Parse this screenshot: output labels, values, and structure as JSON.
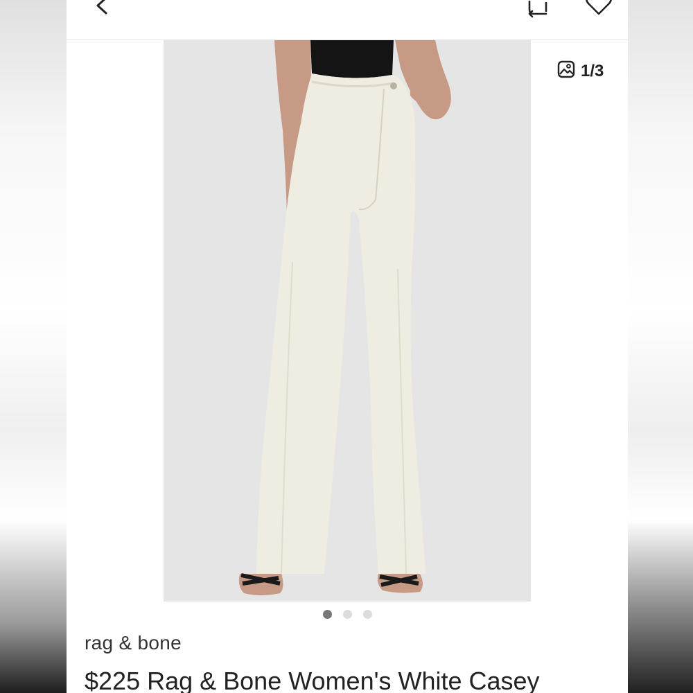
{
  "header": {
    "back_icon": "chevron-left-icon",
    "share_icon": "repost-icon",
    "like_icon": "heart-icon"
  },
  "gallery": {
    "counter_icon": "image-icon",
    "counter_text": "1/3",
    "current_index": 1,
    "total": 3
  },
  "listing": {
    "brand": "rag & bone",
    "title": "$225 Rag & Bone Women's White Casey"
  },
  "colors": {
    "photo_background": "#e5e5e6",
    "jeans": "#efece1",
    "top": "#141414",
    "dot_active": "#777777",
    "dot_inactive": "#dcdcdc"
  }
}
